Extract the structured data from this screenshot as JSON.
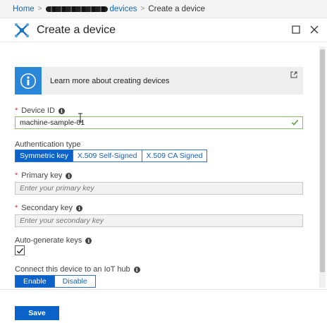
{
  "breadcrumb": {
    "home": "Home",
    "hub": "devices",
    "current": "Create a device"
  },
  "header": {
    "title": "Create a device",
    "icon": "iot-device-icon"
  },
  "info": {
    "text": "Learn more about creating devices",
    "icon": "info-icon"
  },
  "device_id": {
    "label": "Device ID",
    "value": "machine-sample-01"
  },
  "auth": {
    "label": "Authentication type",
    "options": [
      "Symmetric key",
      "X.509 Self-Signed",
      "X.509 CA Signed"
    ],
    "selected": "Symmetric key"
  },
  "primary_key": {
    "label": "Primary key",
    "placeholder": "Enter your primary key"
  },
  "secondary_key": {
    "label": "Secondary key",
    "placeholder": "Enter your secondary key"
  },
  "auto_generate": {
    "label": "Auto-generate keys",
    "checked": true
  },
  "connect": {
    "label": "Connect this device to an IoT hub",
    "options": [
      "Enable",
      "Disable"
    ],
    "selected": "Enable"
  },
  "footer": {
    "save_label": "Save"
  },
  "colors": {
    "accent": "#0b62c9",
    "info_blue": "#2b88d8",
    "required": "#d13438",
    "valid_green": "#5ea03a"
  }
}
